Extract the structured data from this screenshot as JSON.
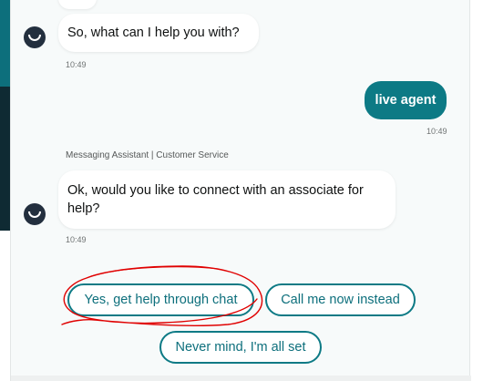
{
  "messages": {
    "bot_1": {
      "text": "So, what can I help you with?",
      "time": "10:49"
    },
    "user_1": {
      "text": "live agent",
      "time": "10:49"
    },
    "sender_label": "Messaging Assistant | Customer Service",
    "bot_2": {
      "text": "Ok, would you like to connect with an associate for help?",
      "time": "10:49"
    }
  },
  "quick_replies": {
    "chat": "Yes, get help through chat",
    "call": "Call me now instead",
    "dismiss": "Never mind, I'm all set"
  },
  "colors": {
    "accent": "#0d7a85",
    "annotation": "#e00000",
    "avatar": "#232f3e"
  },
  "icons": {
    "avatar": "smile-logo-icon"
  }
}
